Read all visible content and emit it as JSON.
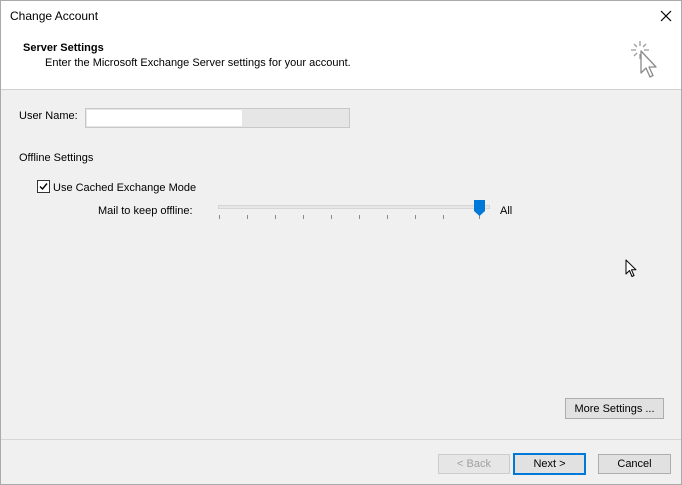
{
  "window": {
    "title": "Change Account"
  },
  "header": {
    "title": "Server Settings",
    "subtitle": "Enter the Microsoft Exchange Server settings for your account."
  },
  "form": {
    "username_label": "User Name:",
    "username_value": "",
    "offline_section_label": "Offline Settings",
    "cached_mode_label": "Use Cached Exchange Mode",
    "cached_mode_checked": true,
    "mail_offline_label": "Mail to keep offline:",
    "mail_offline_value": "All",
    "mail_offline_level": 1.0
  },
  "buttons": {
    "more_settings": "More Settings ...",
    "back": "< Back",
    "next": "Next >",
    "cancel": "Cancel"
  },
  "icons": {
    "header_icon": "sparkle-cursor-icon",
    "close": "close-icon",
    "mouse_cursor": "mouse-pointer-icon"
  },
  "colors": {
    "accent": "#0078d7",
    "window_bg": "#f0f0f0",
    "header_bg": "#ffffff"
  }
}
